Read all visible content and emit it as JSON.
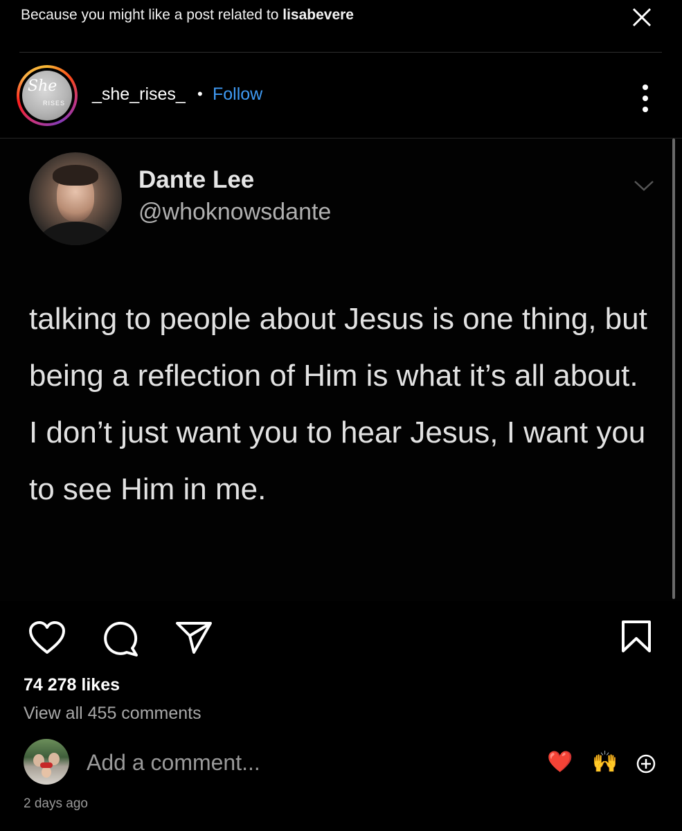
{
  "suggestion": {
    "prefix": "Because you might like a post related to",
    "account": "lisabevere"
  },
  "header": {
    "username": "_she_rises_",
    "separator": "•",
    "follow_label": "Follow",
    "avatar_text": "She",
    "avatar_subtext": "RISES"
  },
  "tweet": {
    "name": "Dante Lee",
    "handle": "@whoknowsdante",
    "text": "talking to people about Jesus is one thing, but being a reflection of Him is what it’s all about. I don’t just want you to hear Jesus, I want you to see Him in me."
  },
  "stats": {
    "likes": "74 278 likes",
    "view_comments": "View all 455 comments"
  },
  "comment": {
    "placeholder": "Add a comment...",
    "quick_emoji_1": "❤️",
    "quick_emoji_2": "🙌"
  },
  "time_ago": "2 days ago",
  "icons": {
    "close": "close-icon",
    "more": "more-vertical-icon",
    "chevron": "chevron-down-icon",
    "like": "heart-icon",
    "comment": "comment-icon",
    "share": "send-icon",
    "save": "bookmark-icon",
    "add": "plus-circle-icon"
  },
  "colors": {
    "background": "#000000",
    "follow": "#3f9af3",
    "muted": "#a8a8a8"
  }
}
